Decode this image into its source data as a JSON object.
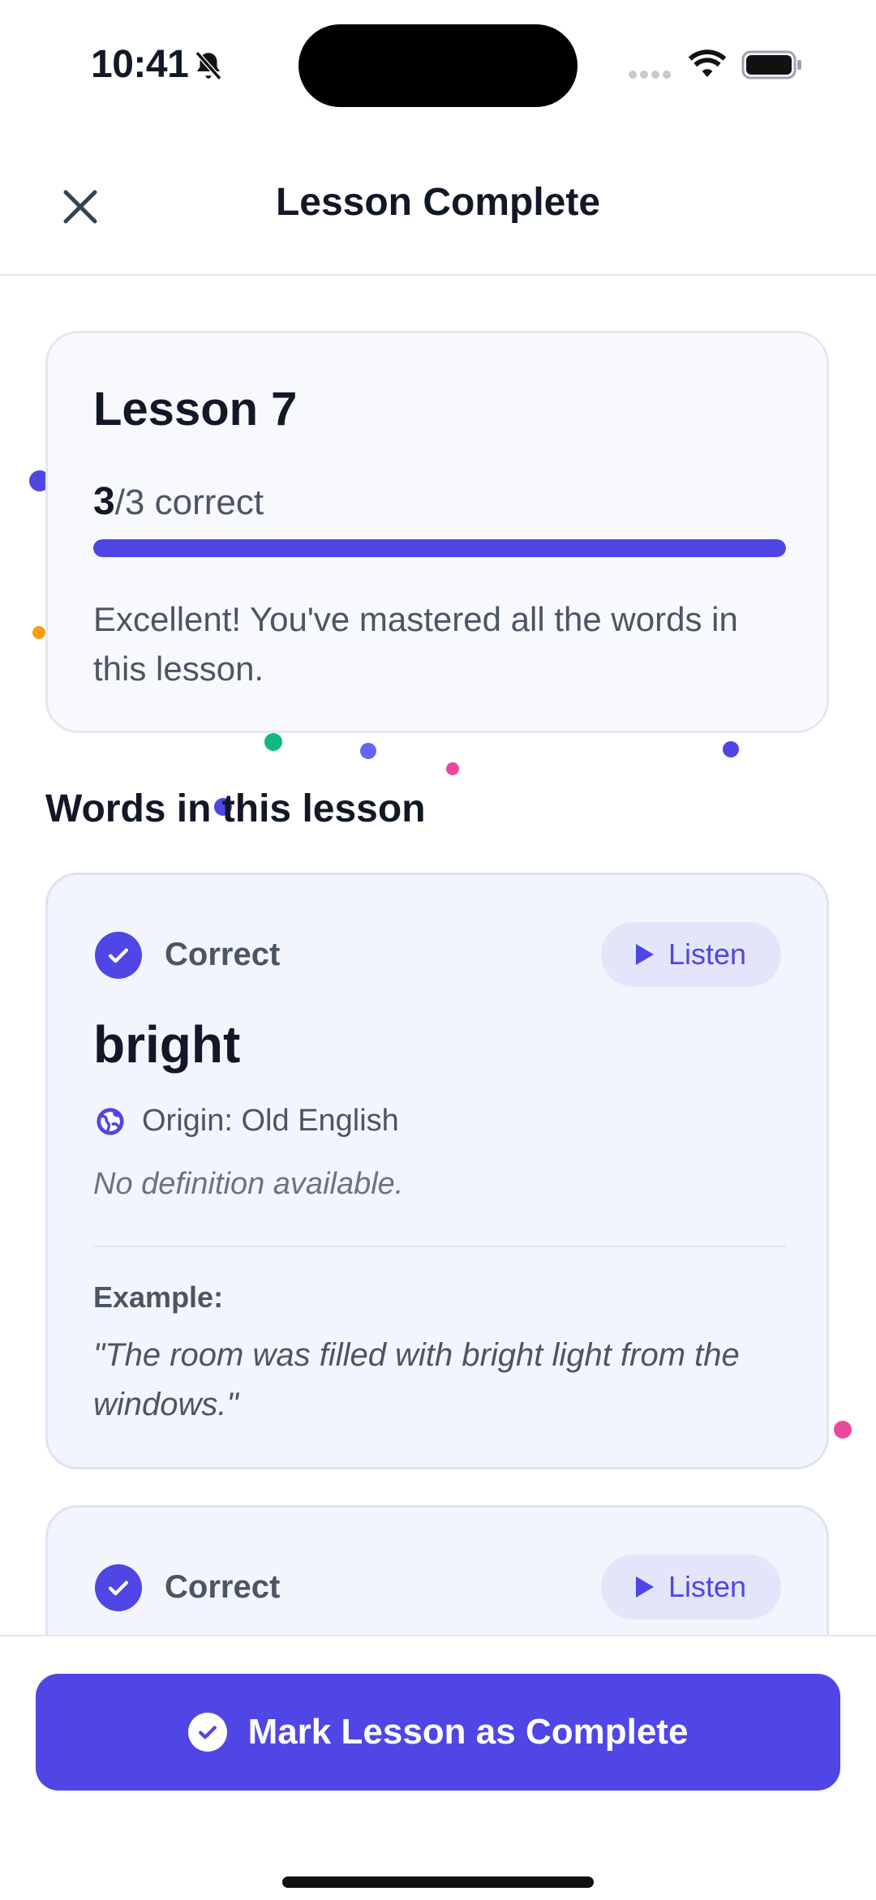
{
  "status_bar": {
    "time": "10:41",
    "icons": [
      "bell-slash-icon",
      "cellular-signal-icon",
      "wifi-icon",
      "battery-icon"
    ]
  },
  "header": {
    "title": "Lesson Complete",
    "close_icon": "close-icon"
  },
  "summary": {
    "lesson_title": "Lesson 7",
    "correct_count": "3",
    "total_text": "/3 correct",
    "progress_fraction": 1.0,
    "message": "Excellent! You've mastered all the words in this lesson."
  },
  "words_section": {
    "heading": "Words in this lesson",
    "items": [
      {
        "status": "Correct",
        "listen_label": "Listen",
        "word": "bright",
        "origin": "Origin: Old English",
        "definition": "No definition available.",
        "example_label": "Example:",
        "example": "\"The room was filled with bright light from the windows.\""
      },
      {
        "status": "Correct",
        "listen_label": "Listen"
      }
    ]
  },
  "footer": {
    "button_label": "Mark Lesson as Complete"
  },
  "colors": {
    "accent": "#4f46e5",
    "confetti": [
      "#4f46e5",
      "#f59e0b",
      "#10b981",
      "#6366f1",
      "#ec4899"
    ]
  }
}
